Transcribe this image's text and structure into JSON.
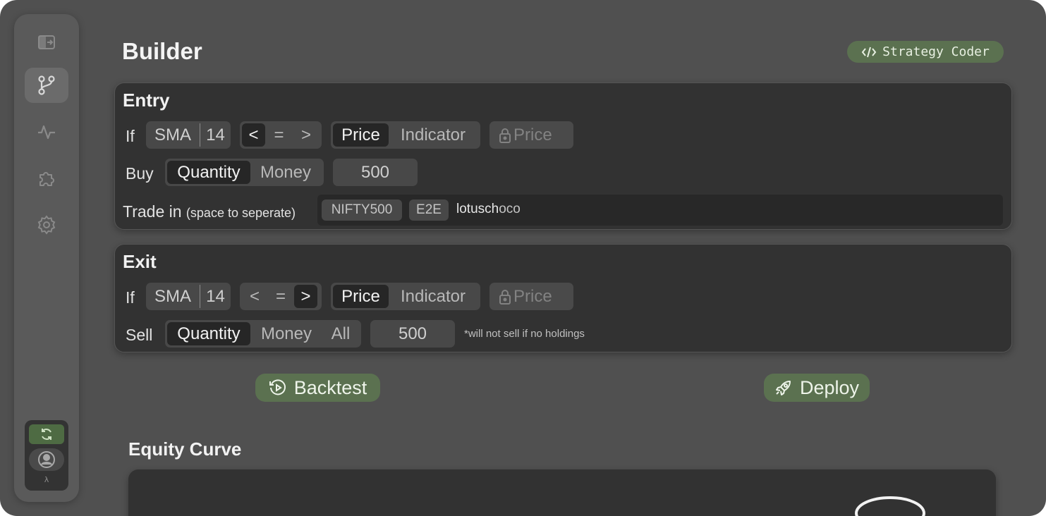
{
  "app": {
    "title": "Builder",
    "strategy_coder_label": "Strategy Coder"
  },
  "sidebar": {
    "items": [
      {
        "icon": "sidebar-toggle-icon",
        "active": false
      },
      {
        "icon": "git-branch-icon",
        "active": true
      },
      {
        "icon": "activity-icon",
        "active": false
      },
      {
        "icon": "puzzle-icon",
        "active": false
      },
      {
        "icon": "gear-icon",
        "active": false
      }
    ],
    "footer": {
      "sync_icon": "sync-icon",
      "avatar_icon": "user-avatar-icon",
      "lambda_label": "λ"
    }
  },
  "entry": {
    "title": "Entry",
    "if_label": "If",
    "indicator": "SMA",
    "period": "14",
    "comparators": [
      "<",
      "=",
      ">"
    ],
    "selected_comparator": "<",
    "compare_modes": [
      "Price",
      "Indicator"
    ],
    "selected_compare_mode": "Price",
    "locked_price_label": "Price",
    "buy_label": "Buy",
    "amount_modes": [
      "Quantity",
      "Money"
    ],
    "selected_amount_mode": "Quantity",
    "amount_value": "500",
    "trade_in_label": "Trade in",
    "trade_in_hint": "(space to seperate)",
    "symbols": [
      "NIFTY500",
      "E2E"
    ],
    "typed_text": "lotusch",
    "typed_suggestion": "oco"
  },
  "exit": {
    "title": "Exit",
    "if_label": "If",
    "indicator": "SMA",
    "period": "14",
    "comparators": [
      "<",
      "=",
      ">"
    ],
    "selected_comparator": ">",
    "compare_modes": [
      "Price",
      "Indicator"
    ],
    "selected_compare_mode": "Price",
    "locked_price_label": "Price",
    "sell_label": "Sell",
    "amount_modes": [
      "Quantity",
      "Money",
      "All"
    ],
    "selected_amount_mode": "Quantity",
    "amount_value": "500",
    "note": "*will not sell if no holdings"
  },
  "actions": {
    "backtest_label": "Backtest",
    "deploy_label": "Deploy"
  },
  "equity": {
    "title": "Equity Curve"
  },
  "colors": {
    "background": "#505050",
    "sidebar": "#5a5a5a",
    "panel": "#323232",
    "accent_green": "#5b7150",
    "selected": "#262626",
    "chip": "#484848"
  }
}
